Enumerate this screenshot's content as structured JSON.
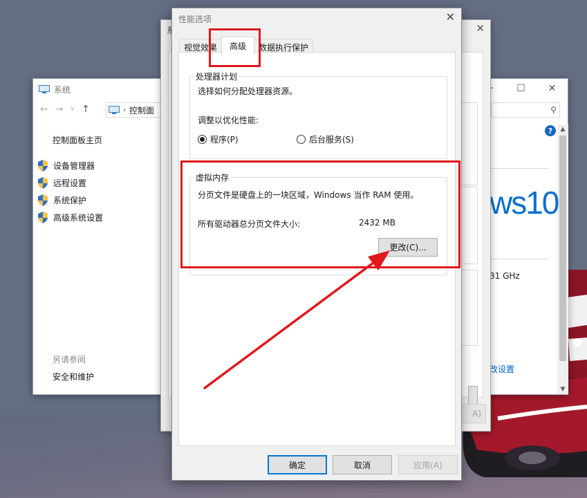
{
  "sys_window": {
    "title": "系统",
    "address": "控制面",
    "nav_home": "控制面板主页",
    "links": [
      "设备管理器",
      "远程设置",
      "系统保护",
      "高级系统设置"
    ],
    "see_also": "另请参阅",
    "security_link": "安全和维护",
    "brand_text": "ws10",
    "cpu_speed": "31 GHz",
    "change_settings": "改设置",
    "help": "?"
  },
  "props_window": {
    "title": "系",
    "apply_label": "A)"
  },
  "perf_dialog": {
    "title": "性能选项",
    "tabs": [
      "视觉效果",
      "高级",
      "数据执行保护"
    ],
    "processor": {
      "legend": "处理器计划",
      "desc": "选择如何分配处理器资源。",
      "optimize_label": "调整以优化性能:",
      "opt_programs": "程序(P)",
      "opt_services": "后台服务(S)"
    },
    "vmem": {
      "legend": "虚拟内存",
      "desc": "分页文件是硬盘上的一块区域，Windows 当作 RAM 使用。",
      "total_label": "所有驱动器总分页文件大小:",
      "total_value": "2432 MB",
      "change_label": "更改(C)..."
    },
    "buttons": {
      "ok": "确定",
      "cancel": "取消",
      "apply": "应用(A)"
    }
  },
  "colors": {
    "annotation": "#e0181e",
    "accent": "#0078d7",
    "brand": "#0a6fcf"
  }
}
